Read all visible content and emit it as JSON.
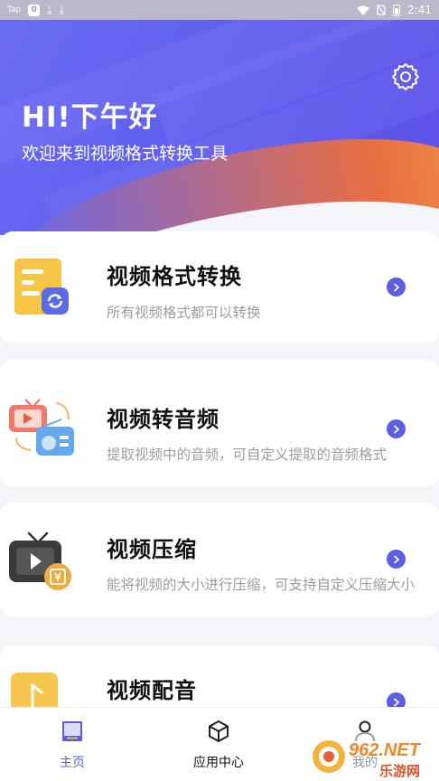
{
  "status_bar": {
    "tag": "Tap",
    "badge": "0",
    "time": "2:41"
  },
  "header": {
    "greeting": "HI!下午好",
    "subtitle": "欢迎来到视频格式转换工具",
    "settings_icon": "gear-icon"
  },
  "cards": [
    {
      "title": "视频格式转换",
      "desc": "所有视频格式都可以转换",
      "icon": "format-convert-icon"
    },
    {
      "title": "视频转音频",
      "desc": "提取视频中的音频，可自定义提取的音频格式",
      "icon": "video-to-audio-icon"
    },
    {
      "title": "视频压缩",
      "desc": "能将视频的大小进行压缩，可支持自定义压缩大小",
      "icon": "video-compress-icon"
    },
    {
      "title": "视频配音",
      "desc": "",
      "icon": "video-dub-icon"
    }
  ],
  "tabbar": {
    "tabs": [
      {
        "label": "主页",
        "icon": "home-icon",
        "active": true
      },
      {
        "label": "应用中心",
        "icon": "cube-icon",
        "active": false
      },
      {
        "label": "我的",
        "icon": "person-icon",
        "active": false
      }
    ]
  },
  "watermark": {
    "brand": "962.NET",
    "name": "乐游网"
  },
  "colors": {
    "accent": "#5b5de2",
    "header_gradient_start": "#6b6cf3",
    "header_orange": "#ef7a45",
    "active_tab": "#5b5de2"
  }
}
